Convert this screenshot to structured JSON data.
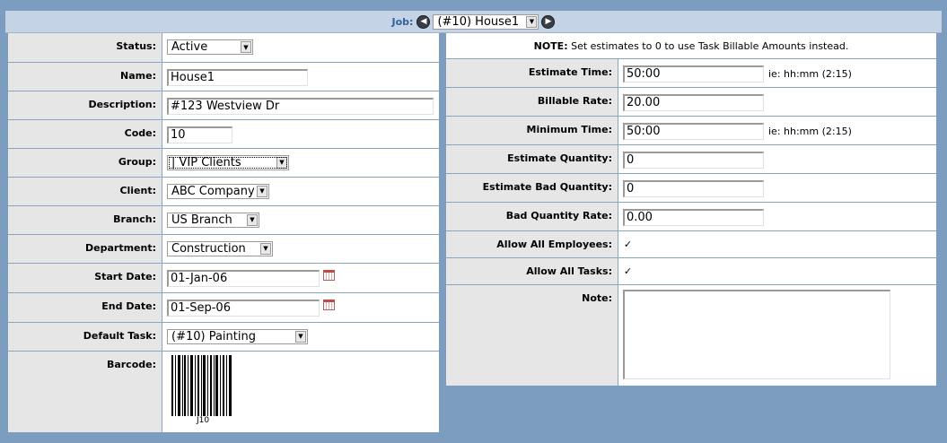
{
  "job_nav": {
    "label": "Job:",
    "selected": "(#10) House1"
  },
  "left": {
    "status": {
      "label": "Status:",
      "value": "Active"
    },
    "name": {
      "label": "Name:",
      "value": "House1"
    },
    "description": {
      "label": "Description:",
      "value": "#123 Westview Dr"
    },
    "code": {
      "label": "Code:",
      "value": "10"
    },
    "group": {
      "label": "Group:",
      "value": "|  VIP Clients"
    },
    "client": {
      "label": "Client:",
      "value": "ABC Company"
    },
    "branch": {
      "label": "Branch:",
      "value": "US Branch"
    },
    "department": {
      "label": "Department:",
      "value": "Construction"
    },
    "start_date": {
      "label": "Start Date:",
      "value": "01-Jan-06"
    },
    "end_date": {
      "label": "End Date:",
      "value": "01-Sep-06"
    },
    "default_task": {
      "label": "Default Task:",
      "value": "(#10) Painting"
    },
    "barcode": {
      "label": "Barcode:",
      "code_text": "J10"
    }
  },
  "right": {
    "note_banner": {
      "bold": "NOTE:",
      "text": " Set estimates to 0 to use Task Billable Amounts instead."
    },
    "estimate_time": {
      "label": "Estimate Time:",
      "value": "50:00",
      "hint": "ie: hh:mm (2:15)"
    },
    "billable_rate": {
      "label": "Billable Rate:",
      "value": "20.00"
    },
    "minimum_time": {
      "label": "Minimum Time:",
      "value": "50:00",
      "hint": "ie: hh:mm (2:15)"
    },
    "estimate_quantity": {
      "label": "Estimate Quantity:",
      "value": "0"
    },
    "estimate_bad_quantity": {
      "label": "Estimate Bad Quantity:",
      "value": "0"
    },
    "bad_quantity_rate": {
      "label": "Bad Quantity Rate:",
      "value": "0.00"
    },
    "allow_all_employees": {
      "label": "Allow All Employees:",
      "checked": true
    },
    "allow_all_tasks": {
      "label": "Allow All Tasks:",
      "checked": true
    },
    "note": {
      "label": "Note:",
      "value": ""
    }
  }
}
